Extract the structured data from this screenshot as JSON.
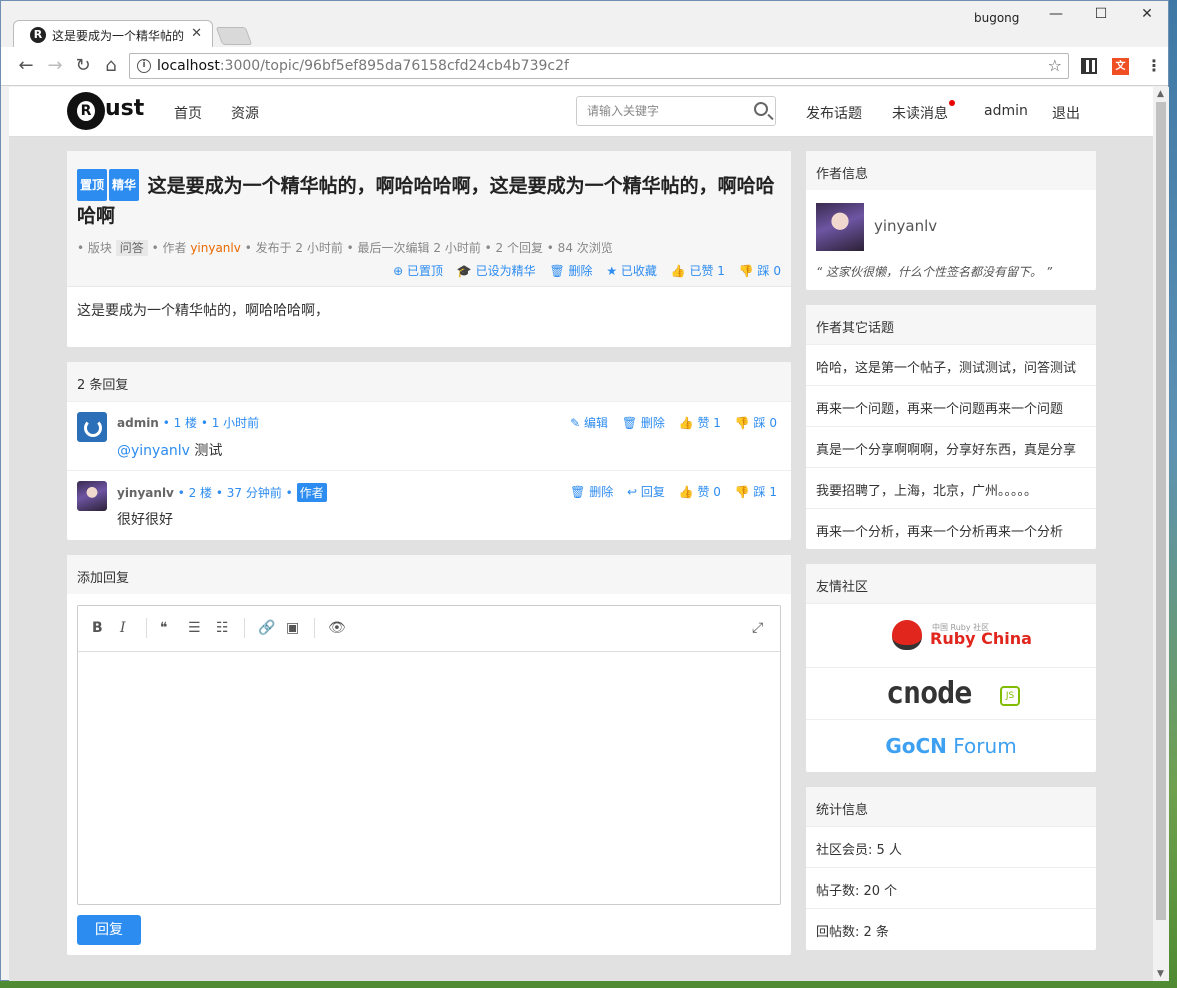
{
  "browser": {
    "tab_title": "这是要成为一个精华帖的",
    "profile_name": "bugong",
    "url_host": "localhost",
    "url_path": ":3000/topic/96bf5ef895da76158cfd24cb4b739c2f"
  },
  "header": {
    "logo_text": "ust",
    "nav": [
      "首页",
      "资源"
    ],
    "search_placeholder": "请输入关键字",
    "right_nav": [
      "发布话题",
      "未读消息",
      "admin",
      "退出"
    ]
  },
  "topic": {
    "badges": [
      "置顶",
      "精华"
    ],
    "title": "这是要成为一个精华帖的，啊哈哈哈啊，这是要成为一个精华帖的，啊哈哈哈啊",
    "meta": {
      "prefix": "• 版块",
      "category": "问答",
      "author_label": "• 作者",
      "author": "yinyanlv",
      "rest": "• 发布于 2 小时前 • 最后一次编辑 2 小时前 • 2 个回复 • 84 次浏览"
    },
    "actions": [
      "⊕ 已置顶",
      "🎓 已设为精华",
      "🗑 删除",
      "★ 已收藏",
      "👍 已赞 1",
      "👎 踩 0"
    ],
    "content": "这是要成为一个精华帖的，啊哈哈哈啊，"
  },
  "replies": {
    "header": "2 条回复",
    "items": [
      {
        "user": "admin",
        "meta": "• 1 楼 • 1 小时前",
        "badge": "",
        "actions": [
          "✎ 编辑",
          "🗑 删除",
          "👍 赞 1",
          "👎 踩 0"
        ],
        "mention": "@yinyanlv",
        "text": " 测试"
      },
      {
        "user": "yinyanlv",
        "meta": "• 2 楼 • 37 分钟前 •",
        "badge": "作者",
        "actions": [
          "🗑 删除",
          "↩ 回复",
          "👍 赞 0",
          "👎 踩 1"
        ],
        "mention": "",
        "text": "很好很好"
      }
    ]
  },
  "add_reply": {
    "header": "添加回复",
    "toolbar": [
      "B",
      "I",
      "❝",
      "☰",
      "☷",
      "🔗",
      "▣",
      "👁",
      "⤢"
    ],
    "button": "回复"
  },
  "sidebar": {
    "author_info": {
      "header": "作者信息",
      "name": "yinyanlv",
      "signature": "“ 这家伙很懒，什么个性签名都没有留下。 ”"
    },
    "other_topics": {
      "header": "作者其它话题",
      "items": [
        "哈哈，这是第一个帖子，测试测试，问答测试",
        "再来一个问题，再来一个问题再来一个问题",
        "真是一个分享啊啊啊，分享好东西，真是分享",
        "我要招聘了，上海，北京，广州。。。。。",
        "再来一个分析，再来一个分析再来一个分析"
      ]
    },
    "friends": {
      "header": "友情社区",
      "ruby_china": "Ruby China",
      "ruby_small": "中国 Ruby 社区",
      "cnode": "cnode",
      "cnode_js": "JS",
      "gocn_a": "GoCN",
      "gocn_b": " Forum"
    },
    "stats": {
      "header": "统计信息",
      "rows": [
        "社区会员: 5 人",
        "帖子数: 20 个",
        "回帖数: 2 条"
      ]
    }
  },
  "colors": {
    "accent": "#2d8cf0",
    "author": "#e96900",
    "unread_dot": "#e00000"
  }
}
